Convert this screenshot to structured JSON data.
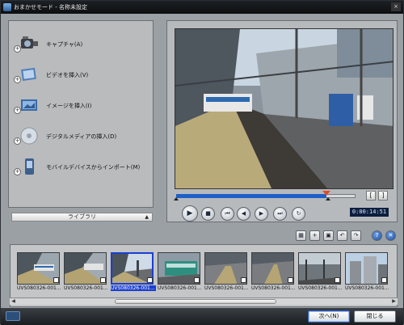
{
  "window": {
    "title": "おまかせモード - 名称未設定",
    "close_glyph": "×"
  },
  "capture_menu": [
    {
      "label": "キャプチャ(A)",
      "icon": "camcorder-icon"
    },
    {
      "label": "ビデオを挿入(V)",
      "icon": "insert-video-icon"
    },
    {
      "label": "イメージを挿入(I)",
      "icon": "insert-image-icon"
    },
    {
      "label": "デジタルメディアの挿入(D)",
      "icon": "disc-media-icon"
    },
    {
      "label": "モバイルデバイスからインポート(M)",
      "icon": "mobile-device-icon"
    }
  ],
  "library": {
    "label": "ライブラリ",
    "arrow": "▲"
  },
  "preview": {
    "timecode": "0:00:14:51",
    "progress": 0.84,
    "mark_in": "[",
    "mark_out": "]"
  },
  "playback_controls": [
    {
      "name": "play-button",
      "glyph": "▶"
    },
    {
      "name": "stop-button",
      "glyph": "■"
    },
    {
      "name": "go-to-start-button",
      "glyph": "⏮"
    },
    {
      "name": "previous-frame-button",
      "glyph": "◀"
    },
    {
      "name": "next-frame-button",
      "glyph": "▶"
    },
    {
      "name": "go-to-end-button",
      "glyph": "⏭"
    },
    {
      "name": "repeat-button",
      "glyph": "↻"
    }
  ],
  "tools": [
    {
      "name": "storyboard-view-icon",
      "glyph": "▦"
    },
    {
      "name": "add-clip-icon",
      "glyph": "+"
    },
    {
      "name": "image-tool-icon",
      "glyph": "▣"
    },
    {
      "name": "undo-icon",
      "glyph": "↶"
    },
    {
      "name": "redo-icon",
      "glyph": "↷"
    },
    {
      "name": "help-icon",
      "glyph": "?"
    },
    {
      "name": "close-tool-icon",
      "glyph": "✕"
    }
  ],
  "clips": [
    {
      "caption": "UVS080326-001...",
      "selected": false,
      "scene": "platform"
    },
    {
      "caption": "UVS080326-001...",
      "selected": false,
      "scene": "platform"
    },
    {
      "caption": "UVS080326-001...",
      "selected": true,
      "scene": "station-sky"
    },
    {
      "caption": "UVS080326-001...",
      "selected": false,
      "scene": "train"
    },
    {
      "caption": "UVS080326-001...",
      "selected": false,
      "scene": "platform"
    },
    {
      "caption": "UVS080326-001...",
      "selected": false,
      "scene": "platform"
    },
    {
      "caption": "UVS080326-001...",
      "selected": false,
      "scene": "platform-dark"
    },
    {
      "caption": "UVS080326-001...",
      "selected": false,
      "scene": "buildings"
    }
  ],
  "buttons": {
    "next": "次へ(N)",
    "close": "閉じる"
  },
  "colors": {
    "accent": "#1e5fc7",
    "selection": "#1a3fd1",
    "timecode_bg": "#0d1f3e",
    "scrub_marker": "#e04a2a"
  }
}
